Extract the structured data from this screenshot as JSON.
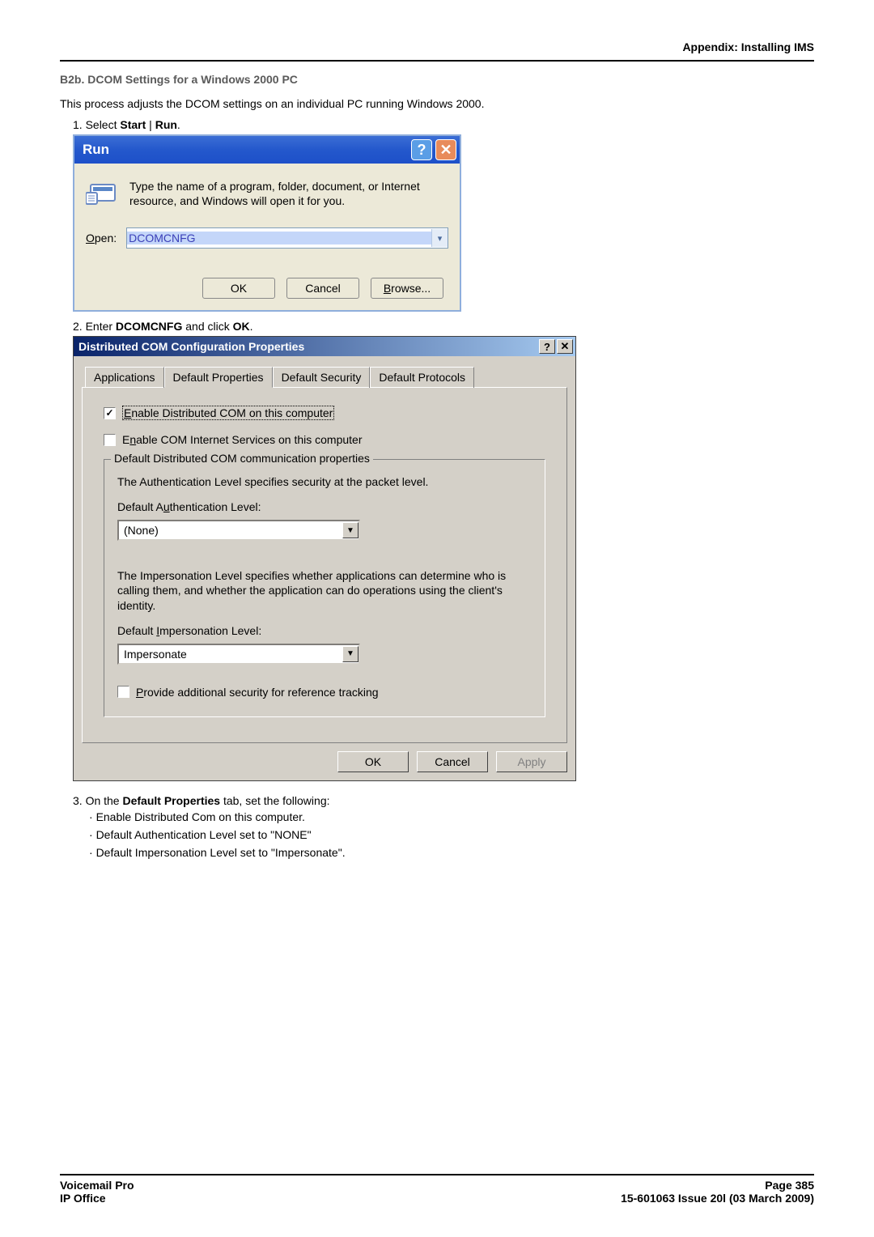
{
  "header": {
    "appendix": "Appendix: Installing IMS"
  },
  "heading": "B2b. DCOM Settings for a Windows 2000 PC",
  "intro": "This process adjusts the DCOM settings on an individual PC running Windows 2000.",
  "steps": {
    "s1_prefix": "1. Select ",
    "s1_b1": "Start",
    "s1_sep": " | ",
    "s1_b2": "Run",
    "s1_suffix": ".",
    "s2_prefix": "2. Enter ",
    "s2_b1": "DCOMCNFG",
    "s2_mid": " and click ",
    "s2_b2": "OK",
    "s2_suffix": ".",
    "s3_prefix": "3. On the ",
    "s3_b1": "Default Properties",
    "s3_suffix": " tab, set the following:"
  },
  "bullets": {
    "b1": "Enable Distributed Com on this computer.",
    "b2_b": "Default Authentication Level",
    "b2_mid": " set to \"",
    "b2_v": "NONE",
    "b2_end": "\"",
    "b3_b": "Default Impersonation Level",
    "b3_mid": " set to \"",
    "b3_v": "Impersonate",
    "b3_end": "\"."
  },
  "run": {
    "title": "Run",
    "desc": "Type the name of a program, folder, document, or Internet resource, and Windows will open it for you.",
    "open_label_u": "O",
    "open_label_rest": "pen:",
    "input_value": "DCOMCNFG",
    "ok": "OK",
    "cancel": "Cancel",
    "browse_u": "B",
    "browse_rest": "rowse..."
  },
  "dcom": {
    "title": "Distributed COM Configuration Properties",
    "tabs": {
      "applications": "Applications",
      "default_properties": "Default Properties",
      "default_security": "Default Security",
      "default_protocols": "Default Protocols"
    },
    "chk1_u": "E",
    "chk1_rest": "nable Distributed COM on this computer",
    "chk2_pre": "E",
    "chk2_u": "n",
    "chk2_rest": "able COM Internet Services on this computer",
    "group_title": "Default Distributed COM communication properties",
    "auth_text": "The Authentication Level specifies security at the packet level.",
    "auth_label_pre": "Default A",
    "auth_label_u": "u",
    "auth_label_rest": "thentication Level:",
    "auth_value": "(None)",
    "imp_text": "The Impersonation Level specifies whether applications can determine who is calling them, and whether the application can do operations using the client's identity.",
    "imp_label_pre": "Default ",
    "imp_label_u": "I",
    "imp_label_rest": "mpersonation Level:",
    "imp_value": "Impersonate",
    "chk3_u": "P",
    "chk3_rest": "rovide additional security for reference tracking",
    "ok": "OK",
    "cancel": "Cancel",
    "apply": "Apply"
  },
  "footer": {
    "left1": "Voicemail Pro",
    "left2": "IP Office",
    "right1": "Page 385",
    "right2": "15-601063 Issue 20l (03 March 2009)"
  }
}
